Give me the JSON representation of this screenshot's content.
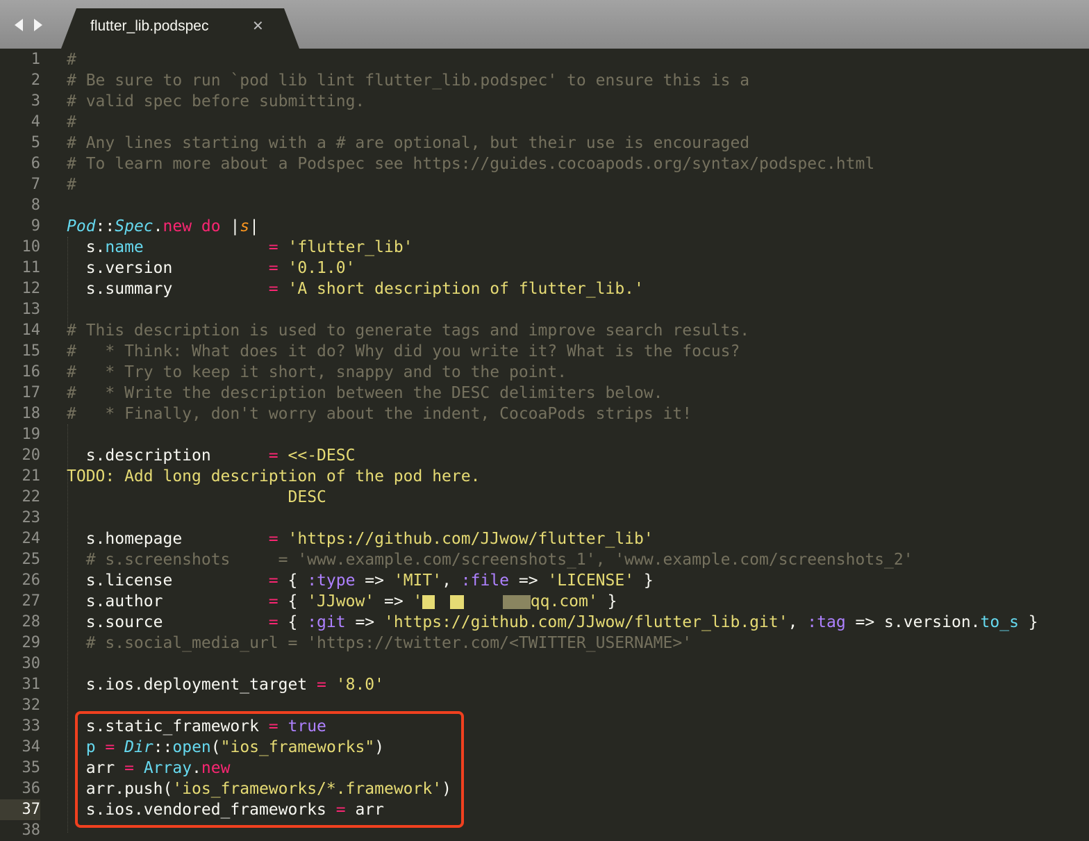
{
  "tab_bar": {
    "back_icon": "chevron-left-icon",
    "forward_icon": "chevron-right-icon",
    "active_tab": {
      "title": "flutter_lib.podspec",
      "close_glyph": "✕"
    }
  },
  "editor": {
    "current_line": 37,
    "line_numbers": [
      "1",
      "2",
      "3",
      "4",
      "5",
      "6",
      "7",
      "8",
      "9",
      "10",
      "11",
      "12",
      "13",
      "14",
      "15",
      "16",
      "17",
      "18",
      "19",
      "20",
      "21",
      "22",
      "23",
      "24",
      "25",
      "26",
      "27",
      "28",
      "29",
      "30",
      "31",
      "32",
      "33",
      "34",
      "35",
      "36",
      "37",
      "38"
    ],
    "lines": [
      [
        [
          "cm",
          "#"
        ]
      ],
      [
        [
          "cm",
          "# Be sure to run `pod lib lint flutter_lib.podspec' to ensure this is a"
        ]
      ],
      [
        [
          "cm",
          "# valid spec before submitting."
        ]
      ],
      [
        [
          "cm",
          "#"
        ]
      ],
      [
        [
          "cm",
          "# Any lines starting with a # are optional, but their use is encouraged"
        ]
      ],
      [
        [
          "cm",
          "# To learn more about a Podspec see https://guides.cocoapods.org/syntax/podspec.html"
        ]
      ],
      [
        [
          "cm",
          "#"
        ]
      ],
      [],
      [
        [
          "cls",
          "Pod"
        ],
        [
          "",
          "::"
        ],
        [
          "cls",
          "Spec"
        ],
        [
          "",
          "."
        ],
        [
          "kw",
          "new"
        ],
        [
          "",
          " "
        ],
        [
          "kw",
          "do"
        ],
        [
          "",
          " |"
        ],
        [
          "arg",
          "s"
        ],
        [
          "",
          "|"
        ]
      ],
      [
        [
          "",
          "  s."
        ],
        [
          "fn",
          "name"
        ],
        [
          "",
          "             "
        ],
        [
          "op",
          "="
        ],
        [
          "",
          " "
        ],
        [
          "str",
          "'flutter_lib'"
        ]
      ],
      [
        [
          "",
          "  s.version          "
        ],
        [
          "op",
          "="
        ],
        [
          "",
          " "
        ],
        [
          "str",
          "'0.1.0'"
        ]
      ],
      [
        [
          "",
          "  s.summary          "
        ],
        [
          "op",
          "="
        ],
        [
          "",
          " "
        ],
        [
          "str",
          "'A short description of flutter_lib.'"
        ]
      ],
      [],
      [
        [
          "cm",
          "# This description is used to generate tags and improve search results."
        ]
      ],
      [
        [
          "cm",
          "#   * Think: What does it do? Why did you write it? What is the focus?"
        ]
      ],
      [
        [
          "cm",
          "#   * Try to keep it short, snappy and to the point."
        ]
      ],
      [
        [
          "cm",
          "#   * Write the description between the DESC delimiters below."
        ]
      ],
      [
        [
          "cm",
          "#   * Finally, don't worry about the indent, CocoaPods strips it!"
        ]
      ],
      [],
      [
        [
          "",
          "  s.description      "
        ],
        [
          "op",
          "="
        ],
        [
          "",
          " "
        ],
        [
          "str",
          "<<-DESC"
        ]
      ],
      [
        [
          "str",
          "TODO: Add long description of the pod here."
        ]
      ],
      [
        [
          "",
          "                       "
        ],
        [
          "str",
          "DESC"
        ]
      ],
      [],
      [
        [
          "",
          "  s.homepage         "
        ],
        [
          "op",
          "="
        ],
        [
          "",
          " "
        ],
        [
          "str",
          "'https://github.com/JJwow/flutter_lib'"
        ]
      ],
      [
        [
          "cm",
          "  # s.screenshots     = 'www.example.com/screenshots_1', 'www.example.com/screenshots_2'"
        ]
      ],
      [
        [
          "",
          "  s.license          "
        ],
        [
          "op",
          "="
        ],
        [
          "",
          " { "
        ],
        [
          "cst",
          ":type"
        ],
        [
          "",
          " => "
        ],
        [
          "str",
          "'MIT'"
        ],
        [
          "",
          ", "
        ],
        [
          "cst",
          ":file"
        ],
        [
          "",
          " => "
        ],
        [
          "str",
          "'LICENSE'"
        ],
        [
          "",
          " }"
        ]
      ],
      [
        [
          "",
          "  s.author           "
        ],
        [
          "op",
          "="
        ],
        [
          "",
          " { "
        ],
        [
          "str",
          "'JJwow'"
        ],
        [
          "",
          " => "
        ],
        [
          "str",
          "'"
        ],
        [
          "redact",
          ""
        ],
        [
          "str",
          "    "
        ],
        [
          "redact2",
          ""
        ],
        [
          "str",
          "qq.com'"
        ],
        [
          "",
          " }"
        ]
      ],
      [
        [
          "",
          "  s.source           "
        ],
        [
          "op",
          "="
        ],
        [
          "",
          " { "
        ],
        [
          "cst",
          ":git"
        ],
        [
          "",
          " => "
        ],
        [
          "str",
          "'https://github.com/JJwow/flutter_lib.git'"
        ],
        [
          "",
          ", "
        ],
        [
          "cst",
          ":tag"
        ],
        [
          "",
          " => s.version."
        ],
        [
          "fn",
          "to_s"
        ],
        [
          "",
          " }"
        ]
      ],
      [
        [
          "cm",
          "  # s.social_media_url = 'https://twitter.com/<TWITTER_USERNAME>'"
        ]
      ],
      [],
      [
        [
          "",
          "  s.ios.deployment_target "
        ],
        [
          "op",
          "="
        ],
        [
          "",
          " "
        ],
        [
          "str",
          "'8.0'"
        ]
      ],
      [],
      [
        [
          "",
          "  s.static_framework "
        ],
        [
          "op",
          "="
        ],
        [
          "",
          " "
        ],
        [
          "cst",
          "true"
        ]
      ],
      [
        [
          "",
          "  "
        ],
        [
          "fn",
          "p"
        ],
        [
          "",
          " "
        ],
        [
          "op",
          "="
        ],
        [
          "",
          " "
        ],
        [
          "cls",
          "Dir"
        ],
        [
          "",
          "::"
        ],
        [
          "fn",
          "open"
        ],
        [
          "",
          "("
        ],
        [
          "str",
          "\"ios_frameworks\""
        ],
        [
          "",
          ")"
        ]
      ],
      [
        [
          "",
          "  arr "
        ],
        [
          "op",
          "="
        ],
        [
          "",
          " "
        ],
        [
          "fn",
          "Array"
        ],
        [
          "",
          "."
        ],
        [
          "kw",
          "new"
        ]
      ],
      [
        [
          "",
          "  arr.push("
        ],
        [
          "str",
          "'ios_frameworks/*.framework'"
        ],
        [
          "",
          ")"
        ]
      ],
      [
        [
          "",
          "  s.ios.vendored_frameworks "
        ],
        [
          "op",
          "="
        ],
        [
          "",
          " arr"
        ]
      ],
      []
    ]
  },
  "colors": {
    "background": "#272822",
    "comment": "#75715e",
    "string": "#e6db74",
    "keyword": "#f92672",
    "type": "#66d9ef",
    "constant": "#ae81ff",
    "highlight_box": "#f0401f"
  }
}
